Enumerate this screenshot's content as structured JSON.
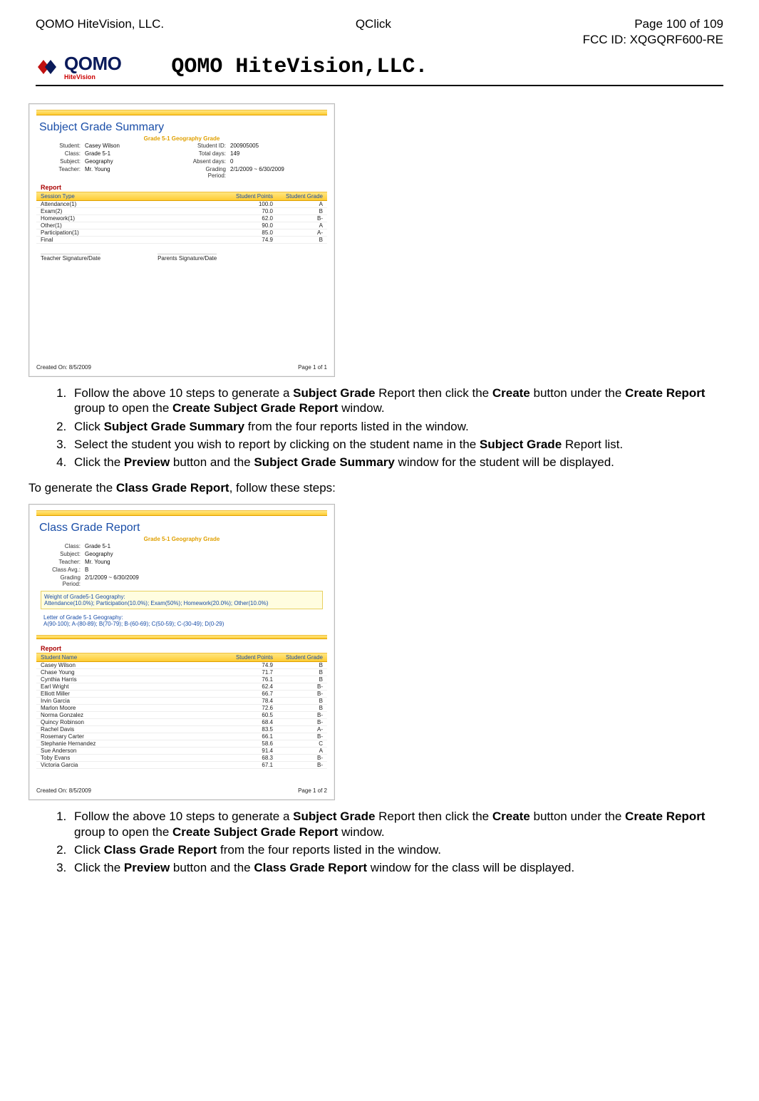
{
  "meta": {
    "company_left": "QOMO HiteVision, LLC.",
    "product_center": "QClick",
    "page_of": "Page 100 of 109",
    "fcc": "FCC ID: XQGQRF600-RE",
    "brand_title": "QOMO HiteVision,LLC.",
    "logo_main": "QOMO",
    "logo_sub": "HiteVision"
  },
  "fig1": {
    "title": "Subject Grade Summary",
    "subtitle": "Grade 5-1 Geography Grade",
    "info_left": [
      {
        "lab": "Student:",
        "val": "Casey Wilson"
      },
      {
        "lab": "Class:",
        "val": "Grade 5-1"
      },
      {
        "lab": "Subject:",
        "val": "Geography"
      },
      {
        "lab": "Teacher:",
        "val": "Mr. Young"
      }
    ],
    "info_right": [
      {
        "lab": "Student  ID:",
        "val": "200905005"
      },
      {
        "lab": "Total  days:",
        "val": "149"
      },
      {
        "lab": "Absent days:",
        "val": "0"
      },
      {
        "lab": "Grading Period:",
        "val": "2/1/2009 ~ 6/30/2009"
      }
    ],
    "section": "Report",
    "head": {
      "c1": "Session Type",
      "c2": "Student Points",
      "c3": "Student Grade"
    },
    "rows": [
      {
        "c1": "Attendance(1)",
        "c2": "100.0",
        "c3": "A"
      },
      {
        "c1": "Exam(2)",
        "c2": "70.0",
        "c3": "B"
      },
      {
        "c1": "Homework(1)",
        "c2": "62.0",
        "c3": "B-"
      },
      {
        "c1": "Other(1)",
        "c2": "90.0",
        "c3": "A"
      },
      {
        "c1": "Participation(1)",
        "c2": "85.0",
        "c3": "A-"
      },
      {
        "c1": "Final",
        "c2": "74.9",
        "c3": "B"
      }
    ],
    "sig1": "Teacher Signature/Date",
    "sig2": "Parents Signature/Date",
    "created": "Created On:  8/5/2009",
    "pagenum": "Page 1 of 1"
  },
  "steps1": {
    "i1a": "Follow the above 10 steps to generate a ",
    "i1b": "Subject Grade",
    "i1c": " Report then click the ",
    "i1d": "Create",
    "i1e": " button under the ",
    "i1f": "Create Report",
    "i1g": " group to open the ",
    "i1h": "Create Subject Grade Report",
    "i1i": " window.",
    "i2a": "Click ",
    "i2b": "Subject Grade Summary",
    "i2c": " from the four reports listed in the window.",
    "i3a": "Select the student you wish to report by clicking on the student name in the ",
    "i3b": "Subject Grade",
    "i3c": " Report list.",
    "i4a": "Click the ",
    "i4b": "Preview",
    "i4c": " button and the ",
    "i4d": "Subject Grade Summary",
    "i4e": " window for the student will be displayed."
  },
  "para2a": "To generate the ",
  "para2b": "Class Grade Report",
  "para2c": ", follow these steps:",
  "fig2": {
    "title": "Class Grade Report",
    "subtitle": "Grade 5-1  Geography  Grade",
    "info": [
      {
        "lab": "Class:",
        "val": "Grade 5-1"
      },
      {
        "lab": "Subject:",
        "val": "Geography"
      },
      {
        "lab": "Teacher:",
        "val": "Mr. Young"
      },
      {
        "lab": "Class Avg.:",
        "val": "B"
      },
      {
        "lab": "Grading Period:",
        "val": "2/1/2009 ~ 6/30/2009"
      }
    ],
    "weight_t": "Weight of Grade5-1 Geography:",
    "weight_v": "Attendance(10.0%); Participation(10.0%); Exam(50%); Homework(20.0%); Other(10.0%)",
    "letter_t": "Letter of Grade 5-1 Geography:",
    "letter_v": "A(90-100); A-(80-89); B(70-79); B-(60-69); C(50-59); C-(30-49); D(0-29)",
    "section": "Report",
    "head": {
      "c1": "Student Name",
      "c2": "Student  Points",
      "c3": "Student Grade"
    },
    "rows": [
      {
        "c1": "Casey Wilson",
        "c2": "74.9",
        "c3": "B"
      },
      {
        "c1": "Chase Young",
        "c2": "71.7",
        "c3": "B"
      },
      {
        "c1": "Cynthia Harris",
        "c2": "76.1",
        "c3": "B"
      },
      {
        "c1": "Earl Wright",
        "c2": "62.4",
        "c3": "B-"
      },
      {
        "c1": "Elliott Miller",
        "c2": "66.7",
        "c3": "B-"
      },
      {
        "c1": "Irvin Garcia",
        "c2": "78.4",
        "c3": "B"
      },
      {
        "c1": "Marlon Moore",
        "c2": "72.6",
        "c3": "B"
      },
      {
        "c1": "Norma Gonzalez",
        "c2": "60.5",
        "c3": "B-"
      },
      {
        "c1": "Quincy Robinson",
        "c2": "68.4",
        "c3": "B-"
      },
      {
        "c1": "Rachel Davis",
        "c2": "83.5",
        "c3": "A-"
      },
      {
        "c1": "Rosemary Carter",
        "c2": "66.1",
        "c3": "B-"
      },
      {
        "c1": "Stephanie Hernandez",
        "c2": "58.6",
        "c3": "C"
      },
      {
        "c1": "Sue Anderson",
        "c2": "91.4",
        "c3": "A"
      },
      {
        "c1": "Toby Evans",
        "c2": "68.3",
        "c3": "B-"
      },
      {
        "c1": "Victoria Garcia",
        "c2": "67.1",
        "c3": "B-"
      }
    ],
    "created": "Created On:  8/5/2009",
    "pagenum": "Page 1 of 2"
  },
  "steps2": {
    "i1a": "Follow the above 10 steps to generate a ",
    "i1b": "Subject Grade",
    "i1c": " Report then click the ",
    "i1d": "Create",
    "i1e": " button under the ",
    "i1f": "Create Report",
    "i1g": " group to open the ",
    "i1h": "Create Subject Grade Report",
    "i1i": " window.",
    "i2a": "Click ",
    "i2b": "Class Grade Report",
    "i2c": " from the four reports listed in the window.",
    "i3a": "Click the ",
    "i3b": "Preview",
    "i3c": " button and the ",
    "i3d": "Class Grade Report",
    "i3e": " window for the class will be displayed."
  }
}
